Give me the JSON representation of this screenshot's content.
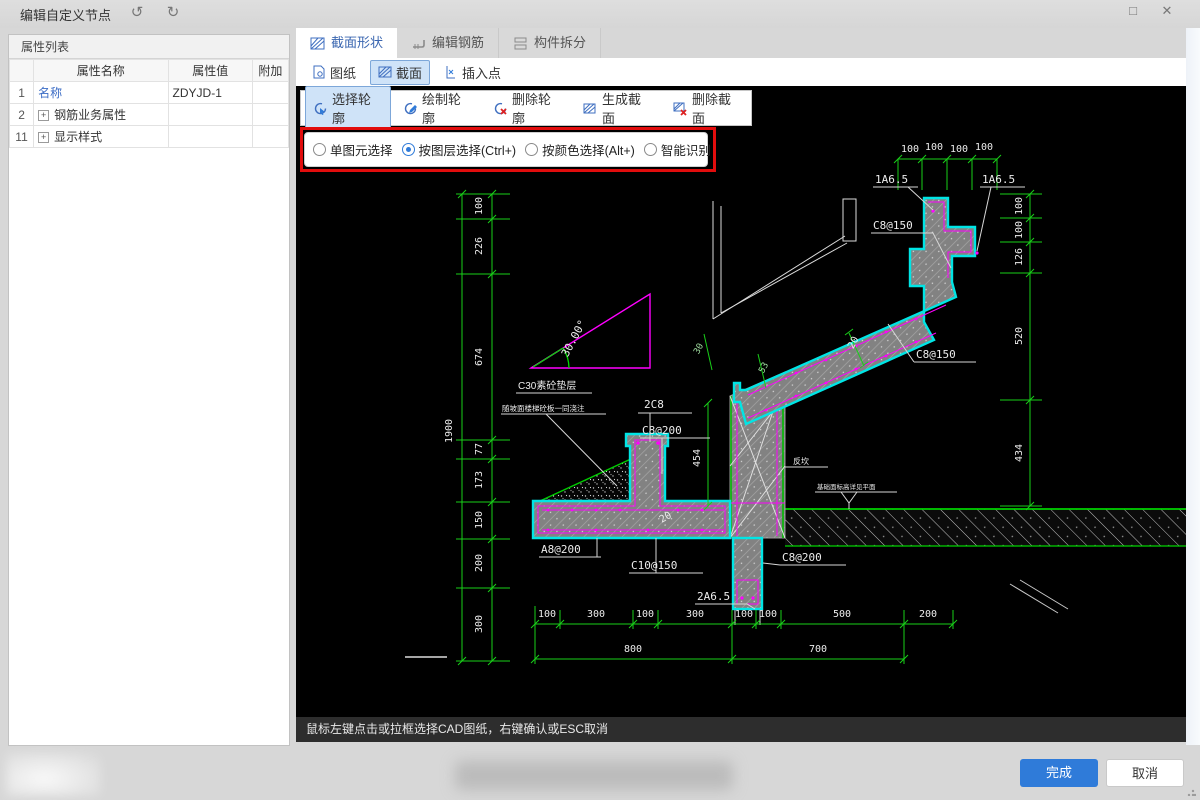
{
  "window": {
    "title": "编辑自定义节点"
  },
  "icons": {
    "undo": "↺",
    "redo": "↻",
    "maximize": "□",
    "close": "✕",
    "expand": "+"
  },
  "property_panel": {
    "title": "属性列表",
    "columns": [
      "属性名称",
      "属性值",
      "附加"
    ],
    "rows": [
      {
        "num": "1",
        "name": "名称",
        "value": "ZDYJD-1",
        "expandable": false
      },
      {
        "num": "2",
        "name": "钢筋业务属性",
        "value": "",
        "expandable": true
      },
      {
        "num": "11",
        "name": "显示样式",
        "value": "",
        "expandable": true
      }
    ]
  },
  "tabs": [
    {
      "label": "截面形状",
      "active": true
    },
    {
      "label": "编辑钢筋",
      "active": false
    },
    {
      "label": "构件拆分",
      "active": false
    }
  ],
  "toolbar1": [
    {
      "label": "图纸",
      "active": false
    },
    {
      "label": "截面",
      "active": true
    },
    {
      "label": "插入点",
      "active": false
    }
  ],
  "toolbar2": [
    {
      "label": "选择轮廓",
      "active": true
    },
    {
      "label": "绘制轮廓",
      "active": false
    },
    {
      "label": "删除轮廓",
      "active": false
    },
    {
      "label": "生成截面",
      "active": false
    },
    {
      "label": "删除截面",
      "active": false
    }
  ],
  "radio_options": [
    {
      "label": "单图元选择",
      "selected": false
    },
    {
      "label": "按图层选择(Ctrl+)",
      "selected": true
    },
    {
      "label": "按颜色选择(Alt+)",
      "selected": false
    },
    {
      "label": "智能识别",
      "selected": false
    }
  ],
  "statusbar": {
    "text": "鼠标左键点击或拉框选择CAD图纸，右键确认或ESC取消"
  },
  "footer": {
    "finish_label": "完成",
    "cancel_label": "取消"
  },
  "colors": {
    "accent": "#2f7bd9",
    "selection_bg": "#cfe3f8",
    "highlight_red": "#e20d0d",
    "outline_cyan": "#00e5e5",
    "rebar_magenta": "#ff00ff",
    "dim_green": "#19cf19"
  },
  "drawing": {
    "dims": {
      "left_total": "1900",
      "left": [
        "100",
        "226",
        "674",
        "77",
        "173",
        "150",
        "200",
        "300"
      ],
      "top": [
        "100",
        "100",
        "100",
        "100"
      ],
      "right": [
        "100",
        "100",
        "126",
        "520",
        "434"
      ],
      "bottom_row1": [
        "100",
        "300",
        "100",
        "300",
        "100",
        "100",
        "500",
        "200"
      ],
      "bottom_row2": [
        "800",
        "700"
      ],
      "angle": "30.00°",
      "wall_height": "454",
      "beam_thickness": "20",
      "slab_thickness": "20",
      "slope_a": "30",
      "slope_b": "53"
    },
    "labels": {
      "top_stirrup": "C8@150",
      "bar_left": "1A6.5",
      "bar_right": "1A6.5",
      "slope_stirrup": "C8@150",
      "stem_bars": "2C8",
      "stem_stirrup": "C8@200",
      "cushion": "C30素砼垫层",
      "cushion_note": "随坡面楼梯砼板一同浇注",
      "slab_bottom": "A8@200",
      "slab_mid": "C10@150",
      "stub_stirrup": "C8@200",
      "stub_bars": "2A6.5",
      "upstand": "反坎",
      "level_note": "基础面标高详见平面"
    }
  }
}
